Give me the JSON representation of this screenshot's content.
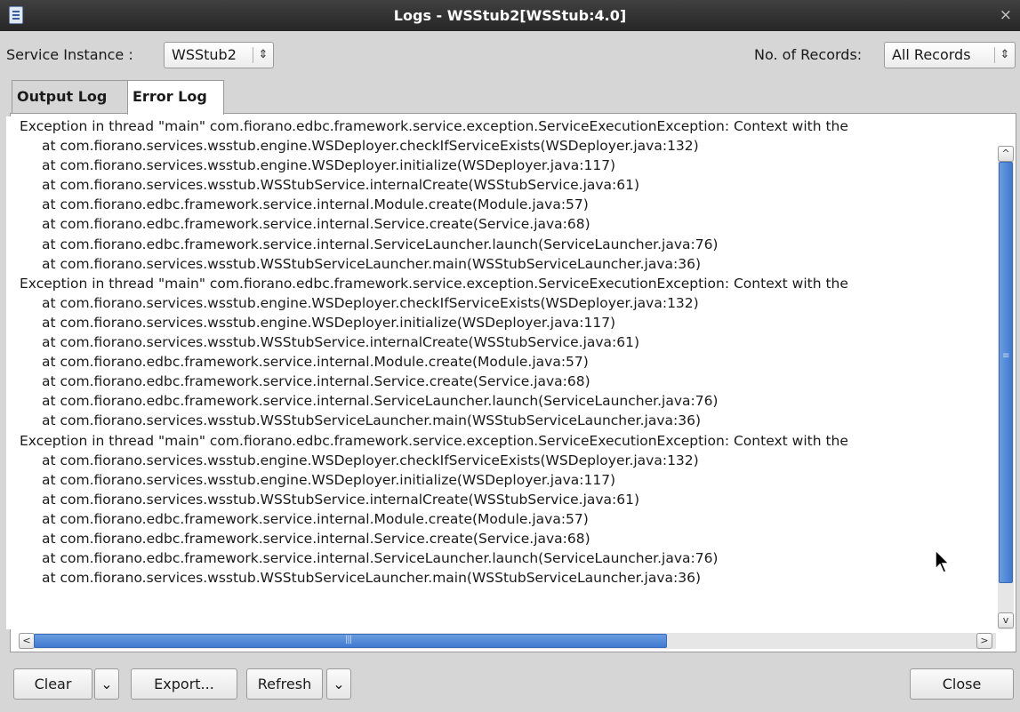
{
  "window": {
    "title": "Logs - WSStub2[WSStub:4.0]"
  },
  "toolbar": {
    "service_instance_label": "Service Instance :",
    "service_instance_value": "WSStub2",
    "records_label": "No. of Records:",
    "records_value": "All Records"
  },
  "tabs": [
    {
      "label": "Output Log",
      "active": false
    },
    {
      "label": "Error Log",
      "active": true
    }
  ],
  "log_lines": [
    "Exception in thread \"main\" com.fiorano.edbc.framework.service.exception.ServiceExecutionException: Context with the",
    "at com.fiorano.services.wsstub.engine.WSDeployer.checkIfServiceExists(WSDeployer.java:132)",
    "at com.fiorano.services.wsstub.engine.WSDeployer.initialize(WSDeployer.java:117)",
    "at com.fiorano.services.wsstub.WSStubService.internalCreate(WSStubService.java:61)",
    "at com.fiorano.edbc.framework.service.internal.Module.create(Module.java:57)",
    "at com.fiorano.edbc.framework.service.internal.Service.create(Service.java:68)",
    "at com.fiorano.edbc.framework.service.internal.ServiceLauncher.launch(ServiceLauncher.java:76)",
    "at com.fiorano.services.wsstub.WSStubServiceLauncher.main(WSStubServiceLauncher.java:36)",
    "Exception in thread \"main\" com.fiorano.edbc.framework.service.exception.ServiceExecutionException: Context with the",
    "at com.fiorano.services.wsstub.engine.WSDeployer.checkIfServiceExists(WSDeployer.java:132)",
    "at com.fiorano.services.wsstub.engine.WSDeployer.initialize(WSDeployer.java:117)",
    "at com.fiorano.services.wsstub.WSStubService.internalCreate(WSStubService.java:61)",
    "at com.fiorano.edbc.framework.service.internal.Module.create(Module.java:57)",
    "at com.fiorano.edbc.framework.service.internal.Service.create(Service.java:68)",
    "at com.fiorano.edbc.framework.service.internal.ServiceLauncher.launch(ServiceLauncher.java:76)",
    "at com.fiorano.services.wsstub.WSStubServiceLauncher.main(WSStubServiceLauncher.java:36)",
    "Exception in thread \"main\" com.fiorano.edbc.framework.service.exception.ServiceExecutionException: Context with the",
    "at com.fiorano.services.wsstub.engine.WSDeployer.checkIfServiceExists(WSDeployer.java:132)",
    "at com.fiorano.services.wsstub.engine.WSDeployer.initialize(WSDeployer.java:117)",
    "at com.fiorano.services.wsstub.WSStubService.internalCreate(WSStubService.java:61)",
    "at com.fiorano.edbc.framework.service.internal.Module.create(Module.java:57)",
    "at com.fiorano.edbc.framework.service.internal.Service.create(Service.java:68)",
    "at com.fiorano.edbc.framework.service.internal.ServiceLauncher.launch(ServiceLauncher.java:76)",
    "at com.fiorano.services.wsstub.WSStubServiceLauncher.main(WSStubServiceLauncher.java:36)"
  ],
  "buttons": {
    "clear": "Clear",
    "export": "Export...",
    "refresh": "Refresh",
    "close": "Close"
  },
  "icons": {
    "app": "app-icon",
    "close": "close-icon",
    "spinner": "updown-arrows-icon",
    "dropdown": "chevron-down-icon",
    "cursor": "mouse-pointer-icon"
  },
  "colors": {
    "titlebar": "#2e2e2e",
    "scroll_thumb": "#4a84d8",
    "background": "#d6d6d6"
  }
}
